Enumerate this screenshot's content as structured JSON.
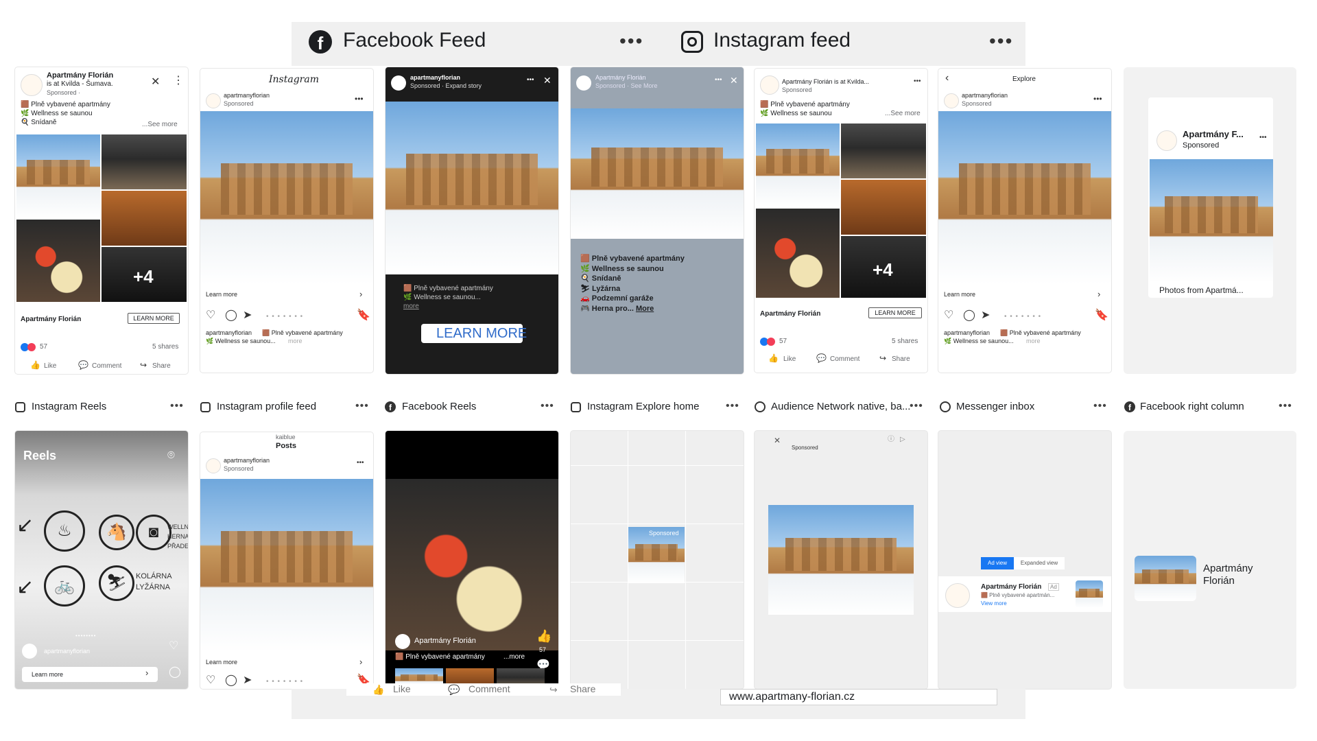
{
  "header": {
    "facebook_title": "Facebook Feed",
    "instagram_title": "Instagram feed",
    "more": "•••"
  },
  "fb_feed": {
    "page_name": "Apartmány Florián",
    "checkin": "is at Kvilda - Šumava.",
    "sponsored": "Sponsored · ",
    "line1": "🟫 Plně vybavené apartmány",
    "line2": "🌿 Wellness se saunou",
    "line3": "🍳 Snídaně",
    "see_more": "...See more",
    "plus": "+4",
    "cta": "LEARN MORE",
    "reactions": "57",
    "shares": "5 shares",
    "like": "Like",
    "comment": "Comment",
    "share": "Share"
  },
  "ig_feed": {
    "logo": "Instagram",
    "account": "apartmanyflorian",
    "sponsored": "Sponsored",
    "learn_more": "Learn more",
    "caption_user": "apartmanyflorian",
    "caption": "🟫 Plně vybavené apartmány",
    "caption2": "🌿 Wellness se saunou...",
    "more": "more"
  },
  "fb_story": {
    "account": "apartmanyflorian",
    "meta": "Sponsored · Expand story",
    "line1": "🟫 Plně vybavené apartmány",
    "line2": "🌿 Wellness se saunou...",
    "more": "more",
    "cta": "LEARN MORE"
  },
  "ig_story": {
    "account": "Apartmány Florián",
    "meta": "Sponsored · See More",
    "lines": [
      "🟫 Plně vybavené apartmány",
      "🌿 Wellness se saunou",
      "🍳 Snídaně",
      "⛷ Lyžárna",
      "🚗 Podzemní garáže",
      "🎮 Herna pro..."
    ],
    "more": "More"
  },
  "fb_feed2": {
    "title": "Apartmány Florián is at Kvilda...",
    "sponsored": "Sponsored",
    "line1": "🟫 Plně vybavené apartmány",
    "line2": "🌿 Wellness se saunou",
    "see_more": "...See more",
    "plus": "+4",
    "page_name": "Apartmány Florián",
    "cta": "LEARN MORE",
    "reactions": "57",
    "shares": "5 shares",
    "like": "Like",
    "comment": "Comment",
    "share": "Share"
  },
  "ig_explore": {
    "title": "Explore",
    "account": "apartmanyflorian",
    "sponsored": "Sponsored",
    "learn_more": "Learn more",
    "caption_user": "apartmanyflorian",
    "caption": "🟫 Plně vybavené apartmány",
    "caption2": "🌿 Wellness se saunou...",
    "more": "more"
  },
  "fb_marketplace": {
    "name": "Apartmány F...",
    "sponsored": "Sponsored",
    "footer": "Photos from Apartmá..."
  },
  "row_labels": [
    {
      "name": "Instagram Reels",
      "icon": "instagram-icon"
    },
    {
      "name": "Instagram profile feed",
      "icon": "instagram-icon"
    },
    {
      "name": "Facebook Reels",
      "icon": "facebook-icon"
    },
    {
      "name": "Instagram Explore home",
      "icon": "instagram-icon"
    },
    {
      "name": "Audience Network native, ba...",
      "icon": "audience-network-icon"
    },
    {
      "name": "Messenger inbox",
      "icon": "messenger-icon"
    },
    {
      "name": "Facebook right column",
      "icon": "facebook-icon"
    }
  ],
  "ig_reels": {
    "title": "Reels",
    "sign1": "WELLNE",
    "sign2": "HERNA",
    "sign3": "PŘADEL",
    "sign4": "KOLÁRNA",
    "sign5": "LYŽÁRNA",
    "account": "apartmanyflorian",
    "learn_more": "Learn more"
  },
  "ig_profile": {
    "profile": "kaiblue",
    "posts": "Posts",
    "account": "apartmanyflorian",
    "sponsored": "Sponsored",
    "learn_more": "Learn more"
  },
  "fb_reels": {
    "account": "Apartmány Florián",
    "caption": "🟫 Plně vybavené apartmány",
    "more": "...more",
    "likes": "57"
  },
  "ig_explore_home": {
    "sponsored": "Sponsored"
  },
  "audience_network": {
    "sponsored": "Sponsored"
  },
  "messenger": {
    "tab_ad": "Ad view",
    "tab_expanded": "Expanded view",
    "name": "Apartmány Florián",
    "ad_badge": "Ad",
    "caption": "🟫 Plně vybavené apartmán...",
    "view_more": "View more"
  },
  "fb_right": {
    "name_line1": "Apartmány",
    "name_line2": "Florián"
  },
  "bottom": {
    "like": "Like",
    "comment": "Comment",
    "share": "Share",
    "url": "www.apartmany-florian.cz"
  },
  "colors": {
    "facebook_blue": "#1877f2",
    "link_blue": "#385898",
    "dark_story": "#1c1c1c",
    "card_bg": "#f2f2f2"
  }
}
